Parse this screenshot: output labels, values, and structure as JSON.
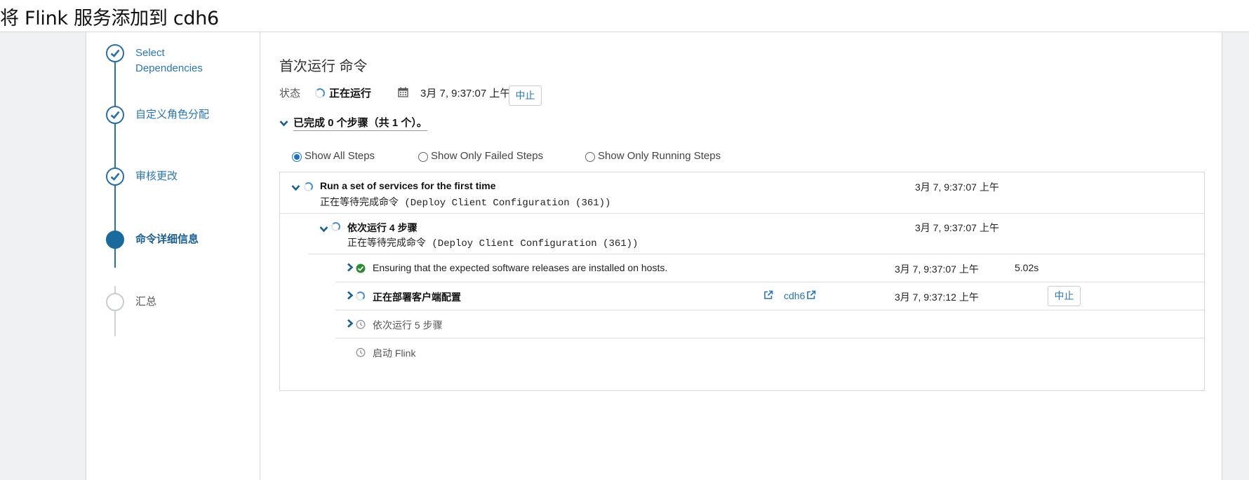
{
  "header": {
    "title": "将 Flink 服务添加到 cdh6"
  },
  "wizard": {
    "steps": [
      {
        "label_line1": "Select",
        "label_line2": "Dependencies",
        "state": "done"
      },
      {
        "label": "自定义角色分配",
        "state": "done"
      },
      {
        "label": "审核更改",
        "state": "done"
      },
      {
        "label": "命令详细信息",
        "state": "active"
      },
      {
        "label": "汇总",
        "state": "todo"
      }
    ]
  },
  "command": {
    "title": "首次运行 命令",
    "status_label": "状态",
    "status_value": "正在运行",
    "timestamp": "3月 7, 9:37:07 上午",
    "abort_label": "中止",
    "progress_text": "已完成 0 个步骤（共 1 个）。"
  },
  "filters": {
    "options": [
      "Show All Steps",
      "Show Only Failed Steps",
      "Show Only Running Steps"
    ],
    "selected": "Show All Steps"
  },
  "steps": {
    "parent": {
      "title": "Run a set of services for the first time",
      "subtitle": "正在等待完成命令 (Deploy Client Configuration (361))",
      "time": "3月 7, 9:37:07 上午"
    },
    "child": {
      "title": "依次运行 4 步骤",
      "subtitle": "正在等待完成命令 (Deploy Client Configuration (361))",
      "time": "3月 7, 9:37:07 上午"
    },
    "items": [
      {
        "text": "Ensuring that the expected software releases are installed on hosts.",
        "time": "3月 7, 9:37:07 上午",
        "duration": "5.02s",
        "status": "success"
      },
      {
        "text": "正在部署客户端配置",
        "link": "cdh6",
        "time": "3月 7, 9:37:12 上午",
        "abort_label": "中止",
        "status": "running"
      },
      {
        "text": "依次运行 5 步骤",
        "status": "pending"
      },
      {
        "text": "启动 Flink",
        "status": "pending"
      }
    ]
  },
  "colors": {
    "accent": "#2a76b0",
    "success": "#2e8b35",
    "active_step": "#1a6a9d"
  }
}
